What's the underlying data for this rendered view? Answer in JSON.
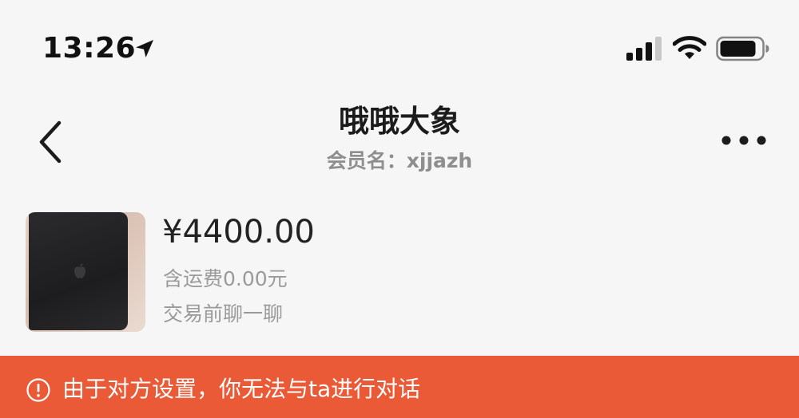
{
  "status_bar": {
    "time": "13:26",
    "icons": [
      "location-arrow-icon",
      "cellular-signal-icon",
      "wifi-icon",
      "battery-icon"
    ]
  },
  "nav": {
    "title": "哦哦大象",
    "subtitle": "会员名：xjjazh",
    "icons": [
      "back-chevron-icon",
      "more-dots-icon"
    ]
  },
  "product": {
    "price": "¥4400.00",
    "shipping": "含运费0.00元",
    "chat_hint": "交易前聊一聊",
    "image_icon": "apple-logo-icon"
  },
  "warning": {
    "text": "由于对方设置，你无法与ta进行对话",
    "icon": "exclamation-circle-icon",
    "bg_color": "#ea5a36"
  }
}
